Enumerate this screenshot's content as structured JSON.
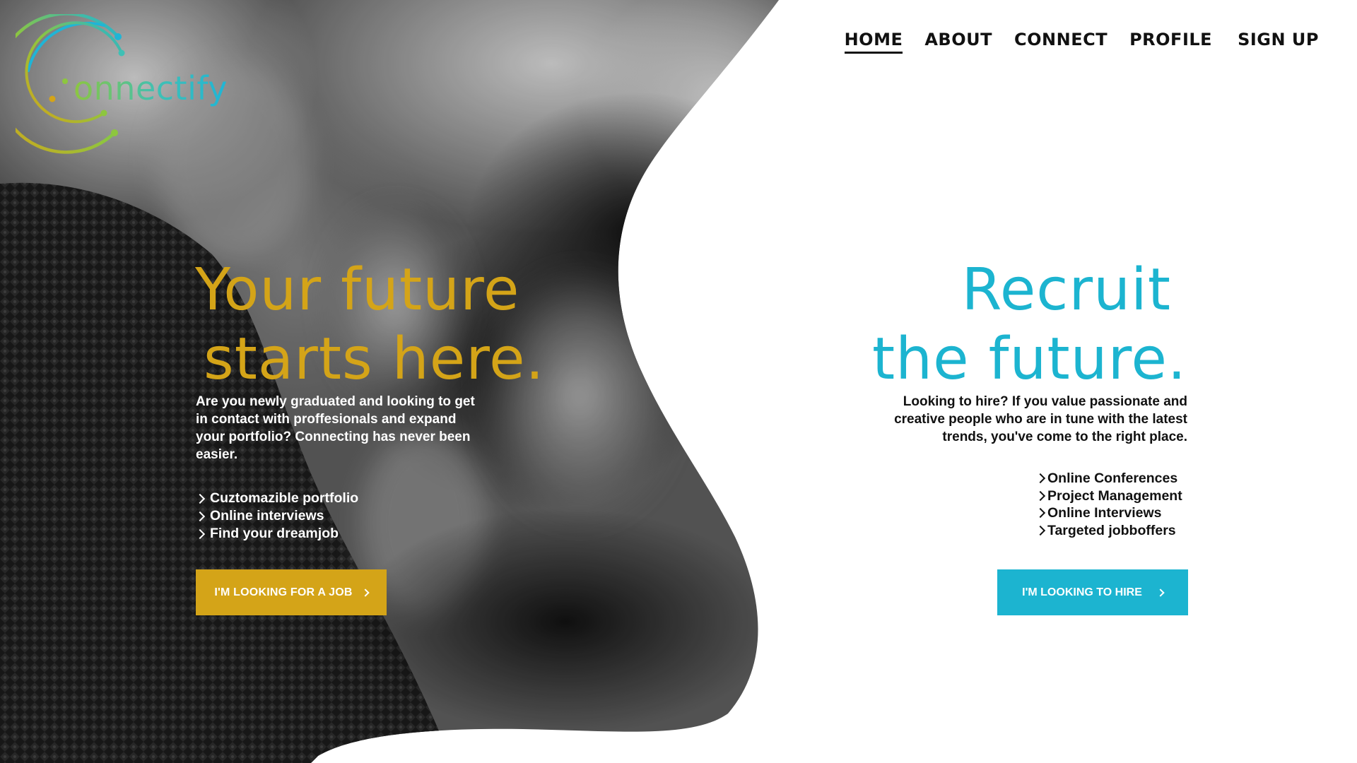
{
  "brand": {
    "logo_text": "onnectify",
    "colors": {
      "gold": "#d4a418",
      "teal": "#1cb4d0",
      "green": "#8dc63f"
    }
  },
  "nav": {
    "items": [
      {
        "label": "HOME",
        "active": true
      },
      {
        "label": "ABOUT",
        "active": false
      },
      {
        "label": "CONNECT",
        "active": false
      },
      {
        "label": "PROFILE",
        "active": false
      },
      {
        "label": "SIGN UP",
        "active": false
      }
    ]
  },
  "job_seekers": {
    "headline_line1": "Your future",
    "headline_line2": "starts here.",
    "description": "Are you newly graduated and looking to get in contact with proffesionals and expand your portfolio? Connecting has never been easier.",
    "features": [
      "Cuztomazible portfolio",
      "Online interviews",
      "Find your dreamjob"
    ],
    "button_label": "I'M LOOKING FOR A JOB",
    "icon": "chevron-right-icon"
  },
  "recruiters": {
    "headline_line1": "Recruit",
    "headline_line2": "the future.",
    "description": "Looking to hire? If you value passionate and creative people who are in tune with the latest trends, you've come to the right place.",
    "features": [
      "Online Conferences",
      "Project Management",
      "Online Interviews",
      "Targeted jobboffers"
    ],
    "button_label": "I'M LOOKING TO HIRE",
    "icon": "chevron-right-icon"
  }
}
